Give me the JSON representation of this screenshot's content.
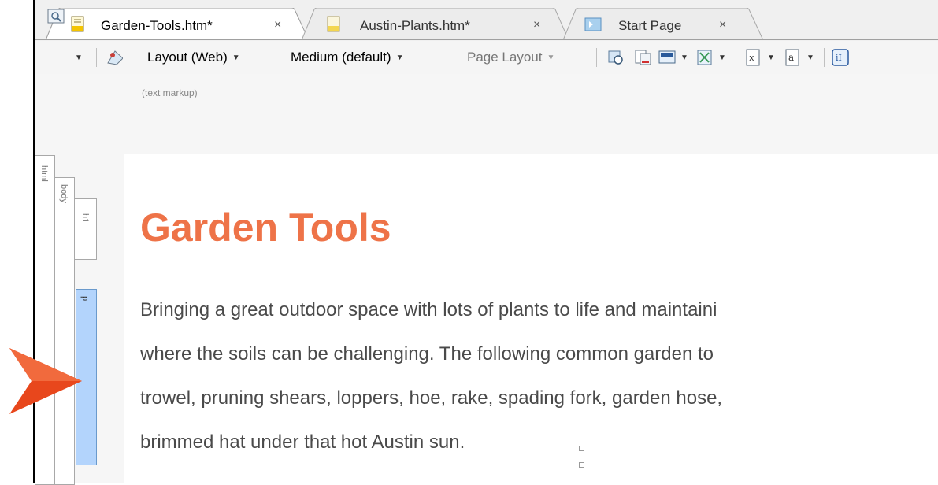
{
  "tabs": [
    {
      "label": "Garden-Tools.htm*",
      "close": "×",
      "active": true
    },
    {
      "label": "Austin-Plants.htm*",
      "close": "×",
      "active": false
    },
    {
      "label": "Start Page",
      "close": "×",
      "active": false
    }
  ],
  "toolbar": {
    "layout_label": "Layout (Web)",
    "medium_label": "Medium (default)",
    "page_layout_label": "Page Layout",
    "caret": "▼",
    "subtitle": "(text markup)"
  },
  "structure_bars": {
    "html": "html",
    "body": "body",
    "h1": "h1",
    "p": "p"
  },
  "document": {
    "heading": "Garden Tools",
    "paragraph_lines": [
      "Bringing a great outdoor space with lots of plants to life and maintaini",
      "where the soils can be challenging. The following common garden to",
      "trowel, pruning shears, loppers, hoe, rake, spading fork, garden hose,",
      "brimmed hat under that hot Austin sun."
    ]
  },
  "colors": {
    "heading": "#ee7348",
    "arrow": "#e8471c",
    "selected_bar": "#b3d4fc"
  }
}
